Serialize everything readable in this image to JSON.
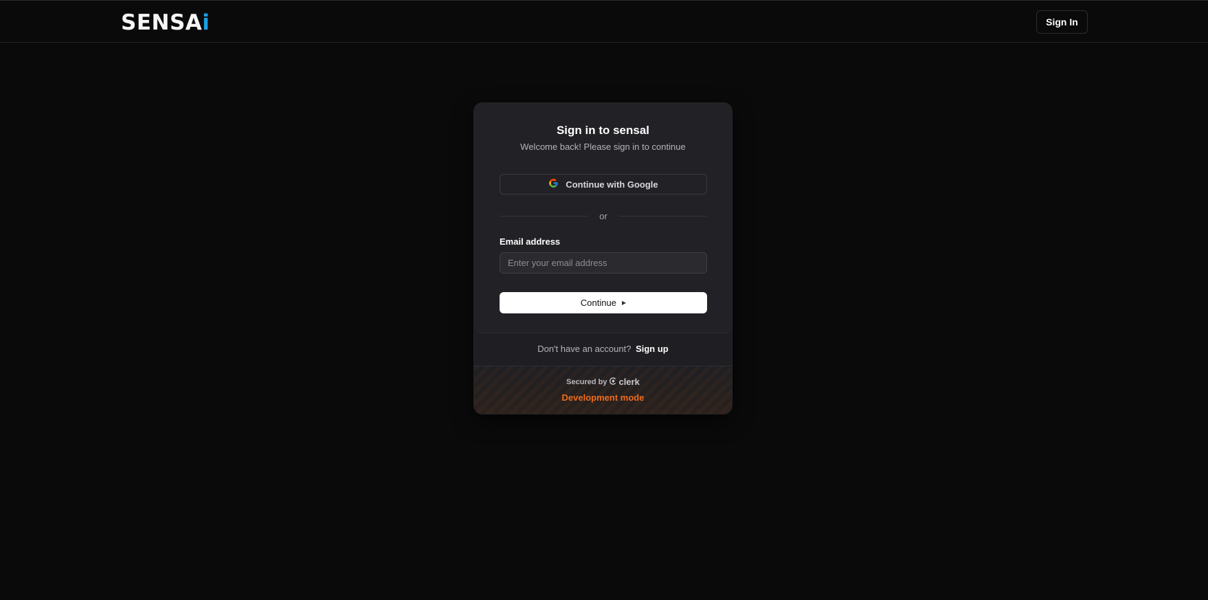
{
  "header": {
    "logo_main": "SENSA",
    "logo_accent": "i",
    "signin_label": "Sign In"
  },
  "card": {
    "title": "Sign in to sensal",
    "subtitle": "Welcome back! Please sign in to continue",
    "google_label": "Continue with Google",
    "divider_text": "or",
    "email_label": "Email address",
    "email_placeholder": "Enter your email address",
    "email_value": "",
    "continue_label": "Continue",
    "signup_prompt": "Don't have an account?",
    "signup_link": "Sign up",
    "secured_by": "Secured by",
    "clerk_name": "clerk",
    "dev_mode": "Development mode"
  },
  "icons": {
    "google": "google-icon",
    "continue_arrow": "triangle-right-icon",
    "clerk": "clerk-logo-icon"
  },
  "colors": {
    "background": "#0a0a0a",
    "card": "#212126",
    "logo_accent": "#1aa0e6",
    "dev_mode": "#f06b1a",
    "primary_button": "#ffffff"
  }
}
